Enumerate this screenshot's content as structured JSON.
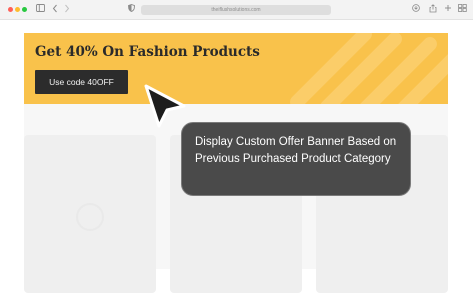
{
  "browser": {
    "url": "theiflushsolutions.com",
    "icons": {
      "window_controls": "traffic-light-dots",
      "sidebar": "sidebar-icon",
      "back": "chevron-left-icon",
      "forward": "chevron-right-icon",
      "privacy": "shield-icon",
      "download": "download-icon",
      "share": "share-icon",
      "new_tab": "plus-icon",
      "tabs": "tabs-overview-icon"
    }
  },
  "banner": {
    "headline": "Get 40% On Fashion Products",
    "coupon_label": "Use code 40OFF",
    "bg_color": "#f9c24b",
    "button_color": "#2c2c2c"
  },
  "tooltip": {
    "text": "Display Custom Offer Banner Based on Previous Purchased Product Category",
    "bg_color": "#4a4a4a"
  },
  "cursor": {
    "icon": "arrow-cursor-icon"
  }
}
